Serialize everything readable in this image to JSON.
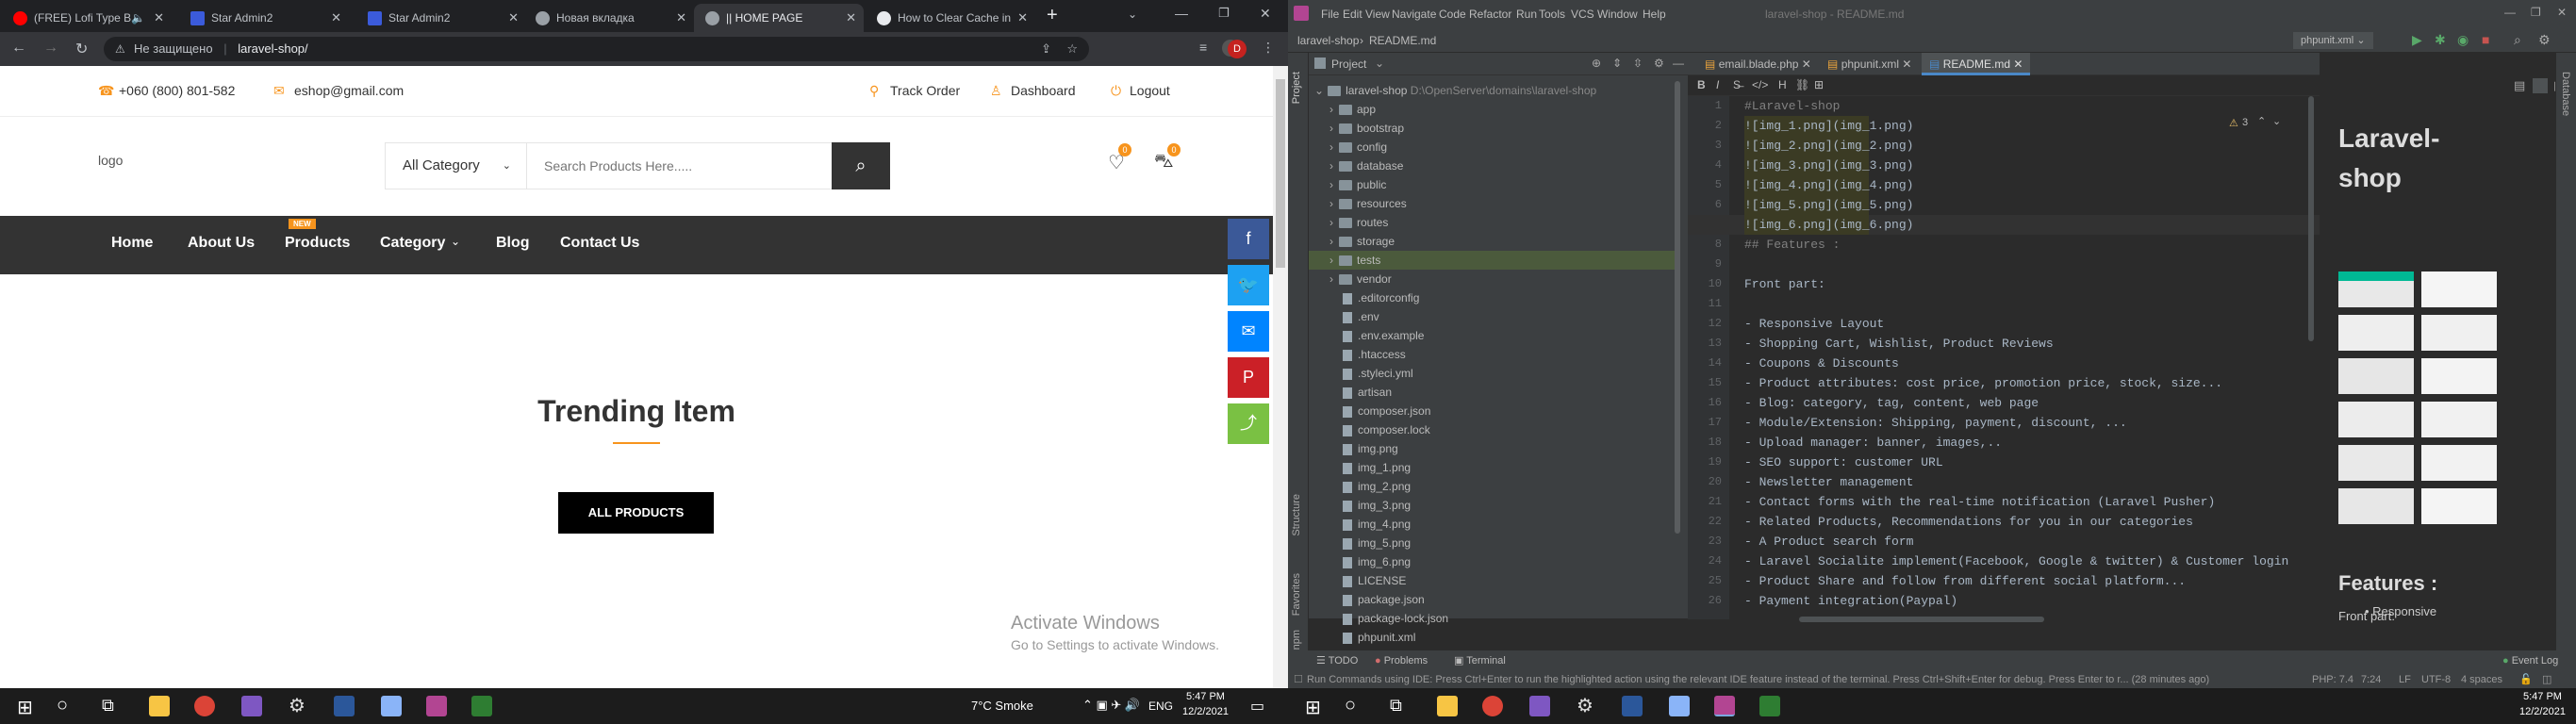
{
  "browser": {
    "tabs": [
      {
        "label": "(FREE) Lofi Type B",
        "color": "#ff0000"
      },
      {
        "label": "Star Admin2",
        "color": "#3b5bdb"
      },
      {
        "label": "Star Admin2",
        "color": "#3b5bdb"
      },
      {
        "label": "Новая вкладка",
        "color": "#9aa0a6"
      },
      {
        "label": "|| HOME PAGE",
        "color": "#9aa0a6"
      },
      {
        "label": "How to Clear Cache in",
        "color": "#e8eaed"
      }
    ],
    "address_warning": "Не защищено",
    "url": "laravel-shop/",
    "profile_initial": "D"
  },
  "site": {
    "phone": "+060 (800) 801-582",
    "email": "eshop@gmail.com",
    "track_order": "Track Order",
    "dashboard": "Dashboard",
    "logout": "Logout",
    "logo_alt": "logo",
    "category_select": "All Category",
    "search_placeholder": "Search Products Here.....",
    "wishlist_count": "0",
    "cart_count": "0",
    "nav": [
      "Home",
      "About Us",
      "Products",
      "Category",
      "Blog",
      "Contact Us"
    ],
    "new_badge": "NEW",
    "trending_title": "Trending Item",
    "all_products": "ALL PRODUCTS",
    "activate_title": "Activate Windows",
    "activate_sub": "Go to Settings to activate Windows."
  },
  "ide": {
    "menu": [
      "File",
      "Edit",
      "View",
      "Navigate",
      "Code",
      "Refactor",
      "Run",
      "Tools",
      "VCS",
      "Window",
      "Help"
    ],
    "window_title": "laravel-shop - README.md",
    "breadcrumb_project": "laravel-shop",
    "breadcrumb_file": "README.md",
    "run_config": "phpunit.xml",
    "project_label": "Project",
    "project_root": "laravel-shop",
    "project_path": "D:\\OpenServer\\domains\\laravel-shop",
    "folders": [
      "app",
      "bootstrap",
      "config",
      "database",
      "public",
      "resources",
      "routes",
      "storage",
      "tests",
      "vendor"
    ],
    "files": [
      ".editorconfig",
      ".env",
      ".env.example",
      ".htaccess",
      ".styleci.yml",
      "artisan",
      "composer.json",
      "composer.lock",
      "img.png",
      "img_1.png",
      "img_2.png",
      "img_3.png",
      "img_4.png",
      "img_5.png",
      "img_6.png",
      "LICENSE",
      "package.json",
      "package-lock.json",
      "phpunit.xml"
    ],
    "editor_tabs": [
      "email.blade.php",
      "phpunit.xml",
      "README.md"
    ],
    "line_numbers": [
      "1",
      "2",
      "3",
      "4",
      "5",
      "6",
      "7",
      "8",
      "9",
      "10",
      "11",
      "12",
      "13",
      "14",
      "15",
      "16",
      "17",
      "18",
      "19",
      "20",
      "21",
      "22",
      "23",
      "24",
      "25",
      "26"
    ],
    "code_lines": [
      "#Laravel-shop",
      "![img_1.png](img_1.png)",
      "![img_2.png](img_2.png)",
      "![img_3.png](img_3.png)",
      "![img_4.png](img_4.png)",
      "![img_5.png](img_5.png)",
      "![img_6.png](img_6.png)",
      "## Features :",
      "",
      "Front part:",
      "",
      "- Responsive Layout",
      "- Shopping Cart, Wishlist, Product Reviews",
      "- Coupons & Discounts",
      "- Product attributes: cost price, promotion price, stock, size...",
      "- Blog: category, tag, content, web page",
      "- Module/Extension: Shipping, payment, discount, ...",
      "- Upload manager: banner, images,..",
      "- SEO support: customer URL",
      "- Newsletter management",
      "- Contact forms with the real-time notification (Laravel Pusher)",
      "- Related Products, Recommendations for you in our categories",
      "- A Product search form",
      "- Laravel Socialite implement(Facebook, Google & twitter) & Customer login",
      "- Product Share and follow from different social platform...",
      "- Payment integration(Paypal)"
    ],
    "inspection_count": "3",
    "preview_title": "Laravel-shop",
    "preview_features": "Features :",
    "preview_front": "Front part:",
    "preview_bullet": "Responsive",
    "bottom_tabs": [
      "TODO",
      "Problems",
      "Terminal"
    ],
    "event_log": "Event Log",
    "status_message": "Run Commands using IDE: Press Ctrl+Enter to run the highlighted action using the relevant IDE feature instead of the terminal. Press Ctrl+Shift+Enter for debug. Press Enter to r... (28 minutes ago)",
    "status_php": "PHP: 7.4",
    "status_pos": "7:24",
    "status_lf": "LF",
    "status_enc": "UTF-8",
    "status_indent": "4 spaces",
    "side_labels": [
      "Project",
      "Structure",
      "Favorites",
      "npm"
    ],
    "right_side_label": "Database"
  },
  "taskbar": {
    "weather": "7°C  Smoke",
    "lang": "ENG",
    "time": "5:47 PM",
    "date": "12/2/2021"
  }
}
